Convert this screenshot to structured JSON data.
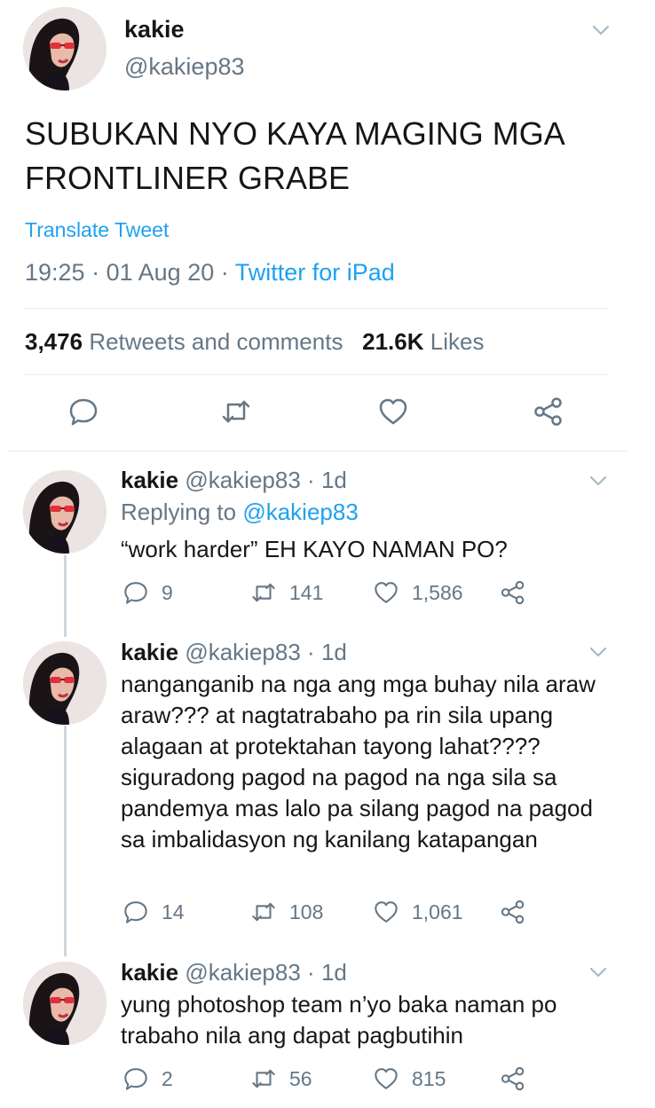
{
  "main_tweet": {
    "name": "kakie",
    "handle": "@kakiep83",
    "text": "SUBUKAN NYO KAYA MAGING MGA FRONTLINER GRABE",
    "translate_label": "Translate Tweet",
    "time": "19:25",
    "date": "01 Aug 20",
    "separator": "·",
    "source": "Twitter for iPad",
    "retweets_count": "3,476",
    "retweets_label": "Retweets and comments",
    "likes_count": "21.6K",
    "likes_label": "Likes"
  },
  "replies": [
    {
      "name": "kakie",
      "handle": "@kakiep83",
      "time": "1d",
      "separator": "·",
      "replying_label": "Replying to",
      "replying_to": "@kakiep83",
      "text": "“work harder” EH KAYO NAMAN PO?",
      "comments": "9",
      "retweets": "141",
      "likes": "1,586"
    },
    {
      "name": "kakie",
      "handle": "@kakiep83",
      "time": "1d",
      "separator": "·",
      "text": "nanganganib na nga ang mga buhay nila araw araw??? at nagtatrabaho pa rin sila upang alagaan at protektahan tayong lahat???? siguradong pagod na pagod na nga sila sa pandemya mas lalo pa silang pagod na pagod sa imbalidasyon ng kanilang katapangan",
      "comments": "14",
      "retweets": "108",
      "likes": "1,061"
    },
    {
      "name": "kakie",
      "handle": "@kakiep83",
      "time": "1d",
      "separator": "·",
      "text": "yung photoshop team n’yo baka naman po trabaho nila ang dapat pagbutihin",
      "comments": "2",
      "retweets": "56",
      "likes": "815"
    }
  ],
  "icons": {
    "comment": "comment-icon",
    "retweet": "retweet-icon",
    "like": "heart-icon",
    "share": "share-icon",
    "more": "chevron-down-icon"
  },
  "colors": {
    "link": "#1da1f2",
    "secondary_text": "#657786",
    "primary_text": "#14171a",
    "divider": "#e6ecf0"
  }
}
